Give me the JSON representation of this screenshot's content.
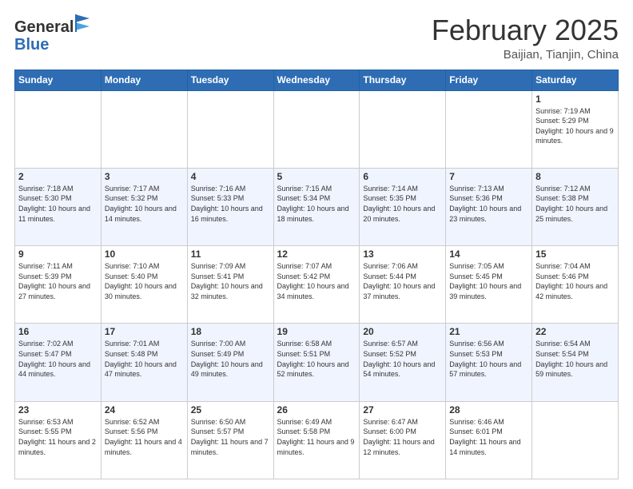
{
  "logo": {
    "general": "General",
    "blue": "Blue"
  },
  "header": {
    "month": "February 2025",
    "location": "Baijian, Tianjin, China"
  },
  "weekdays": [
    "Sunday",
    "Monday",
    "Tuesday",
    "Wednesday",
    "Thursday",
    "Friday",
    "Saturday"
  ],
  "weeks": [
    [
      {
        "day": "",
        "info": ""
      },
      {
        "day": "",
        "info": ""
      },
      {
        "day": "",
        "info": ""
      },
      {
        "day": "",
        "info": ""
      },
      {
        "day": "",
        "info": ""
      },
      {
        "day": "",
        "info": ""
      },
      {
        "day": "1",
        "info": "Sunrise: 7:19 AM\nSunset: 5:29 PM\nDaylight: 10 hours\nand 9 minutes."
      }
    ],
    [
      {
        "day": "2",
        "info": "Sunrise: 7:18 AM\nSunset: 5:30 PM\nDaylight: 10 hours\nand 11 minutes."
      },
      {
        "day": "3",
        "info": "Sunrise: 7:17 AM\nSunset: 5:32 PM\nDaylight: 10 hours\nand 14 minutes."
      },
      {
        "day": "4",
        "info": "Sunrise: 7:16 AM\nSunset: 5:33 PM\nDaylight: 10 hours\nand 16 minutes."
      },
      {
        "day": "5",
        "info": "Sunrise: 7:15 AM\nSunset: 5:34 PM\nDaylight: 10 hours\nand 18 minutes."
      },
      {
        "day": "6",
        "info": "Sunrise: 7:14 AM\nSunset: 5:35 PM\nDaylight: 10 hours\nand 20 minutes."
      },
      {
        "day": "7",
        "info": "Sunrise: 7:13 AM\nSunset: 5:36 PM\nDaylight: 10 hours\nand 23 minutes."
      },
      {
        "day": "8",
        "info": "Sunrise: 7:12 AM\nSunset: 5:38 PM\nDaylight: 10 hours\nand 25 minutes."
      }
    ],
    [
      {
        "day": "9",
        "info": "Sunrise: 7:11 AM\nSunset: 5:39 PM\nDaylight: 10 hours\nand 27 minutes."
      },
      {
        "day": "10",
        "info": "Sunrise: 7:10 AM\nSunset: 5:40 PM\nDaylight: 10 hours\nand 30 minutes."
      },
      {
        "day": "11",
        "info": "Sunrise: 7:09 AM\nSunset: 5:41 PM\nDaylight: 10 hours\nand 32 minutes."
      },
      {
        "day": "12",
        "info": "Sunrise: 7:07 AM\nSunset: 5:42 PM\nDaylight: 10 hours\nand 34 minutes."
      },
      {
        "day": "13",
        "info": "Sunrise: 7:06 AM\nSunset: 5:44 PM\nDaylight: 10 hours\nand 37 minutes."
      },
      {
        "day": "14",
        "info": "Sunrise: 7:05 AM\nSunset: 5:45 PM\nDaylight: 10 hours\nand 39 minutes."
      },
      {
        "day": "15",
        "info": "Sunrise: 7:04 AM\nSunset: 5:46 PM\nDaylight: 10 hours\nand 42 minutes."
      }
    ],
    [
      {
        "day": "16",
        "info": "Sunrise: 7:02 AM\nSunset: 5:47 PM\nDaylight: 10 hours\nand 44 minutes."
      },
      {
        "day": "17",
        "info": "Sunrise: 7:01 AM\nSunset: 5:48 PM\nDaylight: 10 hours\nand 47 minutes."
      },
      {
        "day": "18",
        "info": "Sunrise: 7:00 AM\nSunset: 5:49 PM\nDaylight: 10 hours\nand 49 minutes."
      },
      {
        "day": "19",
        "info": "Sunrise: 6:58 AM\nSunset: 5:51 PM\nDaylight: 10 hours\nand 52 minutes."
      },
      {
        "day": "20",
        "info": "Sunrise: 6:57 AM\nSunset: 5:52 PM\nDaylight: 10 hours\nand 54 minutes."
      },
      {
        "day": "21",
        "info": "Sunrise: 6:56 AM\nSunset: 5:53 PM\nDaylight: 10 hours\nand 57 minutes."
      },
      {
        "day": "22",
        "info": "Sunrise: 6:54 AM\nSunset: 5:54 PM\nDaylight: 10 hours\nand 59 minutes."
      }
    ],
    [
      {
        "day": "23",
        "info": "Sunrise: 6:53 AM\nSunset: 5:55 PM\nDaylight: 11 hours\nand 2 minutes."
      },
      {
        "day": "24",
        "info": "Sunrise: 6:52 AM\nSunset: 5:56 PM\nDaylight: 11 hours\nand 4 minutes."
      },
      {
        "day": "25",
        "info": "Sunrise: 6:50 AM\nSunset: 5:57 PM\nDaylight: 11 hours\nand 7 minutes."
      },
      {
        "day": "26",
        "info": "Sunrise: 6:49 AM\nSunset: 5:58 PM\nDaylight: 11 hours\nand 9 minutes."
      },
      {
        "day": "27",
        "info": "Sunrise: 6:47 AM\nSunset: 6:00 PM\nDaylight: 11 hours\nand 12 minutes."
      },
      {
        "day": "28",
        "info": "Sunrise: 6:46 AM\nSunset: 6:01 PM\nDaylight: 11 hours\nand 14 minutes."
      },
      {
        "day": "",
        "info": ""
      }
    ]
  ]
}
